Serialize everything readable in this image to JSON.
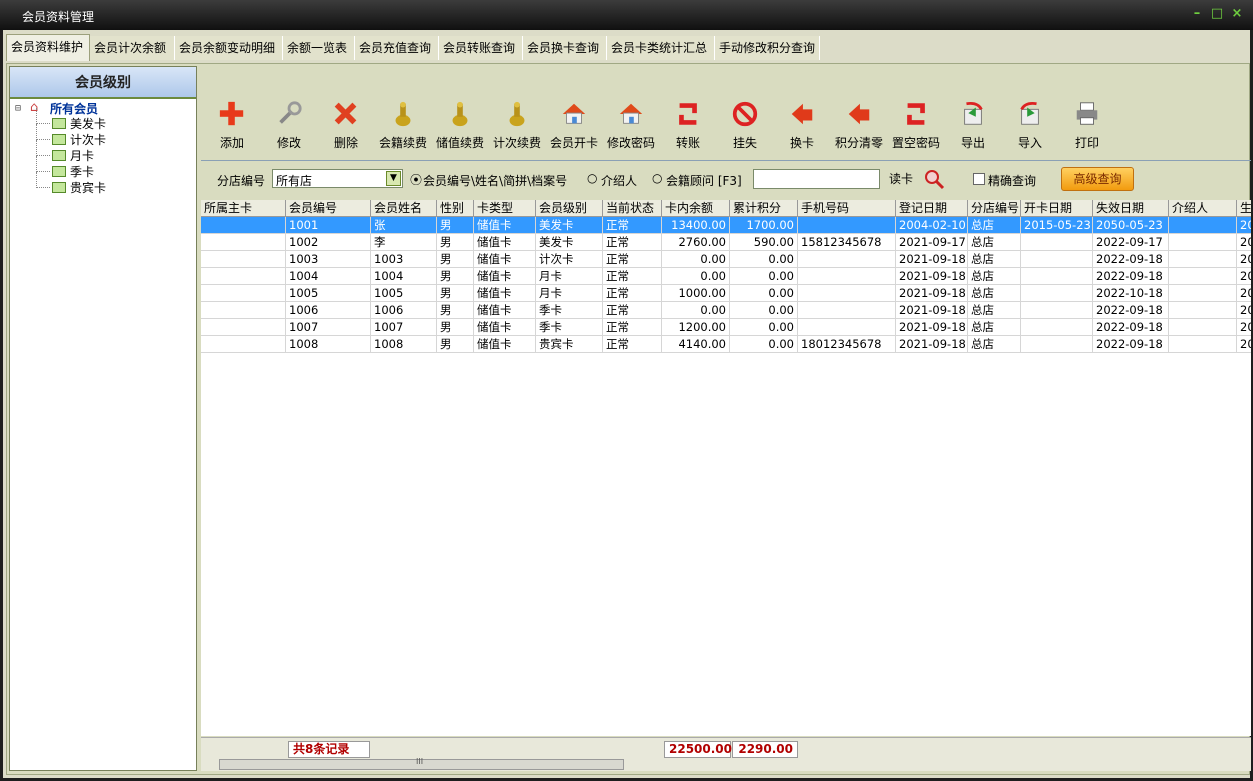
{
  "window": {
    "title": "会员资料管理"
  },
  "tabs": [
    "会员资料维护",
    "会员计次余额",
    "会员余额变动明细",
    "余额一览表",
    "会员充值查询",
    "会员转账查询",
    "会员换卡查询",
    "会员卡类统计汇总",
    "手动修改积分查询"
  ],
  "level_panel": {
    "title": "会员级别",
    "root": "所有会员",
    "items": [
      "美发卡",
      "计次卡",
      "月卡",
      "季卡",
      "贵宾卡"
    ]
  },
  "toolbar": [
    "添加",
    "修改",
    "删除",
    "会籍续费",
    "储值续费",
    "计次续费",
    "会员开卡",
    "修改密码",
    "转账",
    "挂失",
    "换卡",
    "积分清零",
    "置空密码",
    "导出",
    "导入",
    "打印"
  ],
  "query": {
    "branch_label": "分店编号",
    "branch_value": "所有店",
    "radio1": "会员编号\\姓名\\简拼\\档案号",
    "radio2": "介绍人",
    "radio3": "会籍顾问 [F3]",
    "readcard": "读卡",
    "exact": "精确查询",
    "advanced": "高级查询"
  },
  "table": {
    "columns": [
      "所属主卡",
      "会员编号",
      "会员姓名",
      "性别",
      "卡类型",
      "会员级别",
      "当前状态",
      "卡内余额",
      "累计积分",
      "手机号码",
      "登记日期",
      "分店编号",
      "开卡日期",
      "失效日期",
      "介绍人",
      "生"
    ],
    "rows": [
      [
        "",
        "1001",
        "张",
        "男",
        "储值卡",
        "美发卡",
        "正常",
        "13400.00",
        "1700.00",
        "",
        "2004-02-10",
        "总店",
        "2015-05-23",
        "2050-05-23",
        "",
        "20"
      ],
      [
        "",
        "1002",
        "李",
        "男",
        "储值卡",
        "美发卡",
        "正常",
        "2760.00",
        "590.00",
        "15812345678",
        "2021-09-17",
        "总店",
        "",
        "2022-09-17",
        "",
        "20"
      ],
      [
        "",
        "1003",
        "1003",
        "男",
        "储值卡",
        "计次卡",
        "正常",
        "0.00",
        "0.00",
        "",
        "2021-09-18",
        "总店",
        "",
        "2022-09-18",
        "",
        "20"
      ],
      [
        "",
        "1004",
        "1004",
        "男",
        "储值卡",
        "月卡",
        "正常",
        "0.00",
        "0.00",
        "",
        "2021-09-18",
        "总店",
        "",
        "2022-09-18",
        "",
        "20"
      ],
      [
        "",
        "1005",
        "1005",
        "男",
        "储值卡",
        "月卡",
        "正常",
        "1000.00",
        "0.00",
        "",
        "2021-09-18",
        "总店",
        "",
        "2022-10-18",
        "",
        "20"
      ],
      [
        "",
        "1006",
        "1006",
        "男",
        "储值卡",
        "季卡",
        "正常",
        "0.00",
        "0.00",
        "",
        "2021-09-18",
        "总店",
        "",
        "2022-09-18",
        "",
        "20"
      ],
      [
        "",
        "1007",
        "1007",
        "男",
        "储值卡",
        "季卡",
        "正常",
        "1200.00",
        "0.00",
        "",
        "2021-09-18",
        "总店",
        "",
        "2022-09-18",
        "",
        "20"
      ],
      [
        "",
        "1008",
        "1008",
        "男",
        "储值卡",
        "贵宾卡",
        "正常",
        "4140.00",
        "0.00",
        "18012345678",
        "2021-09-18",
        "总店",
        "",
        "2022-09-18",
        "",
        "20"
      ]
    ]
  },
  "footer": {
    "count": "共8条记录",
    "balance_total": "22500.00",
    "points_total": "2290.00",
    "scroll_grip": "III"
  },
  "colors": {
    "selected_row": "#3399ff",
    "accent_red": "#b10000",
    "advanced_btn": "#f5a623"
  }
}
